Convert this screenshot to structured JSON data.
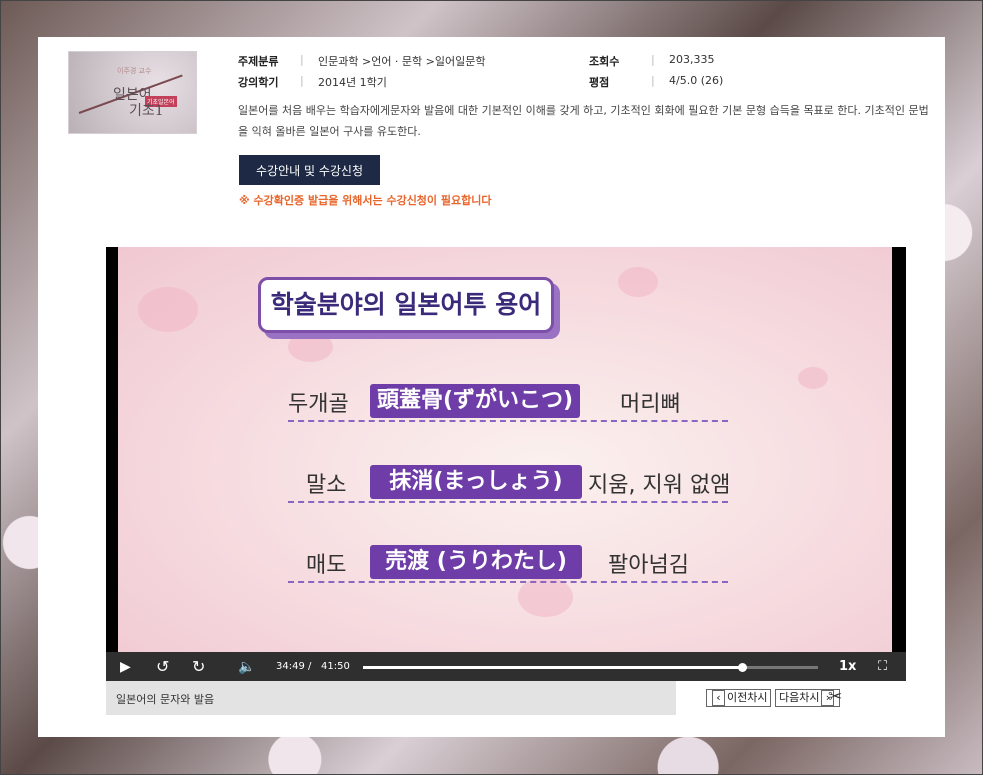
{
  "course": {
    "thumbnail": {
      "sub_text": "이주경 교수",
      "title_line1": "일본어",
      "badge": "기초일본어",
      "title_line2": "기초1"
    },
    "meta": {
      "category_label": "주제분류",
      "category_value": "인문과학 >언어 · 문학 >일어일문학",
      "semester_label": "강의학기",
      "semester_value": "2014년 1학기",
      "views_label": "조회수",
      "views_value": "203,335",
      "rating_label": "평점",
      "rating_value": "4/5.0 (26)"
    },
    "description": "일본어를 처음 배우는 학습자에게문자와 발음에 대한 기본적인 이해를 갖게 하고, 기초적인 회화에 필요한 기본 문형 습득을 목표로 한다. 기초적인 문법을 익혀 올바른 일본어 구사를 유도한다.",
    "apply_button": "수강안내 및 수강신청",
    "notice": "※ 수강확인증 발급을 위해서는 수강신청이 필요합니다"
  },
  "video": {
    "slide_title": "학술분야의 일본어투 용어",
    "terms": [
      {
        "korean": "두개골",
        "japanese": "頭蓋骨(ずがいこつ)",
        "meaning": "머리뼈"
      },
      {
        "korean": "말소",
        "japanese": "抹消(まっしょう)",
        "meaning": "지움, 지워 없앰"
      },
      {
        "korean": "매도",
        "japanese": "売渡 (うりわたし)",
        "meaning": "팔아넘김"
      }
    ]
  },
  "player": {
    "current_time": "34:49",
    "separator": "/",
    "total_time": "41:50",
    "progress_fraction": 0.832,
    "speed": "1x"
  },
  "lecture": {
    "title": "일본어의 문자와 발음",
    "prev_button": "이전차시",
    "next_button": "다음차시"
  },
  "icons": {
    "play": "play-icon",
    "rewind": "rewind-10-icon",
    "forward": "forward-10-icon",
    "volume": "volume-icon",
    "fullscreen": "fullscreen-icon",
    "scissors": "scissors-icon"
  },
  "colors": {
    "button_bg": "#1e2a45",
    "notice": "#e8652b",
    "term_highlight": "#6f3da7"
  }
}
